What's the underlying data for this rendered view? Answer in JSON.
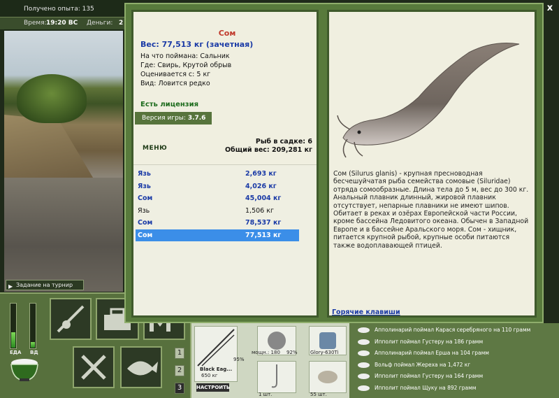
{
  "hud": {
    "xp_label": "Получено опыта: 135",
    "time_label": "Время:",
    "time_value": "19:20 ВС",
    "money_label": "Деньги:",
    "money_value": "2"
  },
  "tournament_button": "Задание на турнир",
  "meters": {
    "food_label": "ЕДА",
    "water_label": "ВД"
  },
  "nav_numbers": [
    "1",
    "2",
    "3"
  ],
  "tackle": {
    "rod_name": "Black Eag...",
    "rod_weight": "650 кг",
    "rod_percent": "95%",
    "reel_caption": "мощн.: 180",
    "reel_percent": "92%",
    "line_name": "Glory-630Ti",
    "hook_qty": "1 шт.",
    "bait_qty": "55 шт.",
    "setup_button": "НАСТРОИТЬ"
  },
  "feed": [
    "Апполинарий поймал Карася серебряного на 110 грамм",
    "Ипполит поймал Густеру на 186 грамм",
    "Апполинарий поймал Ерша на 104 грамм",
    "Вольф поймал Жереха на 1,472 кг",
    "Ипполит поймал Густеру на 164 грамм",
    "Ипполит поймал Щуку на 892 грамм"
  ],
  "modal": {
    "close_glyph": "x",
    "fish_title": "Сом",
    "fish_weight": "Вес: 77,513 кг (зачетная)",
    "caught_with": "На что поймана: Сальник",
    "location": "Где: Свирь, Крутой обрыв",
    "valued_from": "Оценивается с: 5 кг",
    "rarity": "Вид: Ловится редко",
    "license": "Есть лицензия",
    "version_label": "Версия игры:",
    "version_value": "3.7.6",
    "menu_button": "МЕНЮ",
    "keepnet_count": "Рыб в садке: 6",
    "keepnet_total": "Общий вес: 209,281 кг",
    "catch_list": [
      {
        "name": "Язь",
        "weight": "2,693 кг",
        "style": "blue"
      },
      {
        "name": "Язь",
        "weight": "4,026 кг",
        "style": "blue"
      },
      {
        "name": "Сом",
        "weight": "45,004 кг",
        "style": "blue"
      },
      {
        "name": "Язь",
        "weight": "1,506 кг",
        "style": "plain"
      },
      {
        "name": "Сом",
        "weight": "78,537 кг",
        "style": "blue"
      },
      {
        "name": "Сом",
        "weight": "77,513 кг",
        "style": "selected"
      }
    ],
    "description": "Сом (Silurus glanis) - крупная пресноводная бесчешуйчатая рыба семейства сомовые (Siluridae) отряда сомообразные. Длина тела до 5 м, вес до 300 кг. Анальный плавник длинный, жировой плавник отсутствует, непарные плавники не имеют шипов. Обитает в реках и озёрах Европейской части России, кроме бассейна Ледовитого океана. Обычен в Западной Европе и в бассейне Аральского моря. Сом - хищник, питается крупной рыбой, крупные особи питаются также водоплавающей птицей.",
    "hotkeys_link": "Горячие клавиши"
  },
  "colors": {
    "panel_green": "#587a3c",
    "selection_blue": "#3b8ee8",
    "title_red": "#c0392b",
    "value_blue": "#1a3aa6"
  },
  "levels": {
    "food_fraction": 0.35,
    "water_fraction": 0.12
  }
}
